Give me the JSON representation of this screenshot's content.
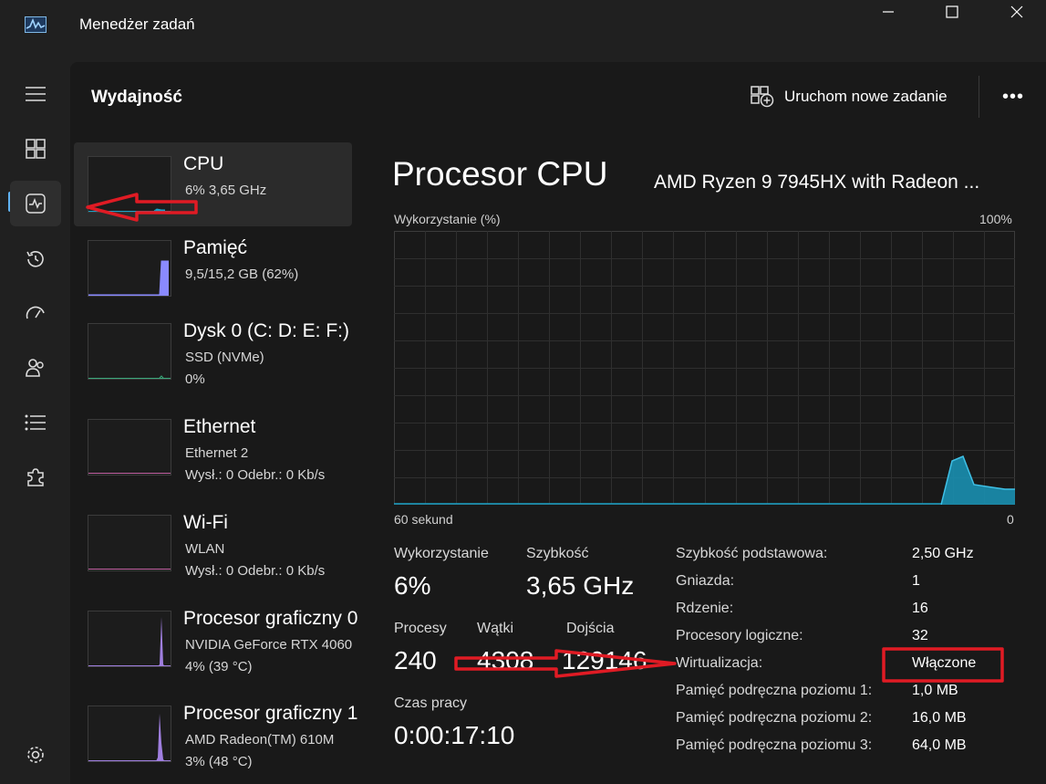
{
  "window": {
    "title": "Menedżer zadań"
  },
  "header": {
    "title": "Wydajność",
    "run_task_label": "Uruchom nowe zadanie"
  },
  "devices": [
    {
      "name": "CPU",
      "line1": "6%  3,65 GHz",
      "line2": ""
    },
    {
      "name": "Pamięć",
      "line1": "9,5/15,2 GB (62%)",
      "line2": ""
    },
    {
      "name": "Dysk 0 (C: D: E: F:)",
      "line1": "SSD (NVMe)",
      "line2": "0%"
    },
    {
      "name": "Ethernet",
      "line1": "Ethernet 2",
      "line2": "Wysł.: 0  Odebr.: 0 Kb/s"
    },
    {
      "name": "Wi-Fi",
      "line1": "WLAN",
      "line2": "Wysł.: 0  Odebr.: 0 Kb/s"
    },
    {
      "name": "Procesor graficzny 0",
      "line1": "NVIDIA GeForce RTX 4060",
      "line2": "4%  (39 °C)"
    },
    {
      "name": "Procesor graficzny 1",
      "line1": "AMD Radeon(TM) 610M",
      "line2": "3%  (48 °C)"
    }
  ],
  "detail": {
    "title": "Procesor CPU",
    "subtitle": "AMD Ryzen 9 7945HX with Radeon ...",
    "graph_label": "Wykorzystanie (%)",
    "graph_max": "100%",
    "graph_time": "60 sekund",
    "graph_min": "0"
  },
  "stats": {
    "utilization_label": "Wykorzystanie",
    "utilization_value": "6%",
    "speed_label": "Szybkość",
    "speed_value": "3,65 GHz",
    "processes_label": "Procesy",
    "processes_value": "240",
    "threads_label": "Wątki",
    "threads_value": "4308",
    "handles_label": "Dojścia",
    "handles_value": "129146",
    "uptime_label": "Czas pracy",
    "uptime_value": "0:00:17:10"
  },
  "properties": [
    {
      "label": "Szybkość podstawowa:",
      "value": "2,50 GHz"
    },
    {
      "label": "Gniazda:",
      "value": "1"
    },
    {
      "label": "Rdzenie:",
      "value": "16"
    },
    {
      "label": "Procesory logiczne:",
      "value": "32"
    },
    {
      "label": "Wirtualizacja:",
      "value": "Włączone"
    },
    {
      "label": "Pamięć podręczna poziomu 1:",
      "value": "1,0 MB"
    },
    {
      "label": "Pamięć podręczna poziomu 2:",
      "value": "16,0 MB"
    },
    {
      "label": "Pamięć podręczna poziomu 3:",
      "value": "64,0 MB"
    }
  ],
  "colors": {
    "cpu": "#1aa2c8",
    "memory": "#8a8aff",
    "ethernet": "#c05fa0",
    "gpu": "#a07fe0",
    "accent": "#5fb2f2",
    "annotation": "#e01b24"
  }
}
